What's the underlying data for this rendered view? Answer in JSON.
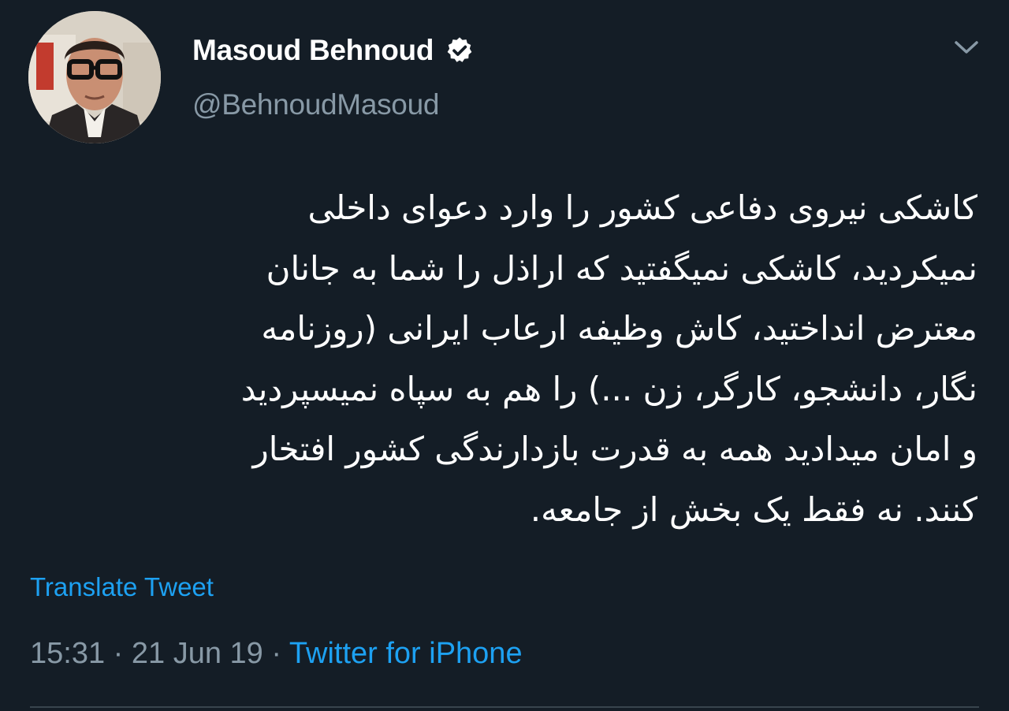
{
  "profile": {
    "display_name": "Masoud Behnoud",
    "handle": "@BehnoudMasoud",
    "verified": true,
    "verified_icon": "verified-badge-icon"
  },
  "menu": {
    "icon": "chevron-down-icon"
  },
  "tweet": {
    "lines": [
      "کاشکی نیروی دفاعی کشور را وارد دعوای داخلی",
      "نمیکردید، کاشکی نمیگفتید که اراذل را شما به جانان",
      "معترض انداختید، کاش وظیفه ارعاب ایرانی (روزنامه",
      "نگار، دانشجو، کارگر، زن ...) را هم به سپاه نمیسپردید",
      "و امان میدادید همه به قدرت بازدارندگی کشور افتخار",
      "کنند. نه فقط یک بخش از جامعه."
    ],
    "translate_label": "Translate Tweet",
    "time": "15:31",
    "date": "21 Jun 19",
    "separator": " · ",
    "source": "Twitter for iPhone"
  },
  "colors": {
    "background": "#141d26",
    "text": "#ffffff",
    "secondary": "#8899a6",
    "accent": "#1da1f2",
    "divider": "#38444d"
  }
}
